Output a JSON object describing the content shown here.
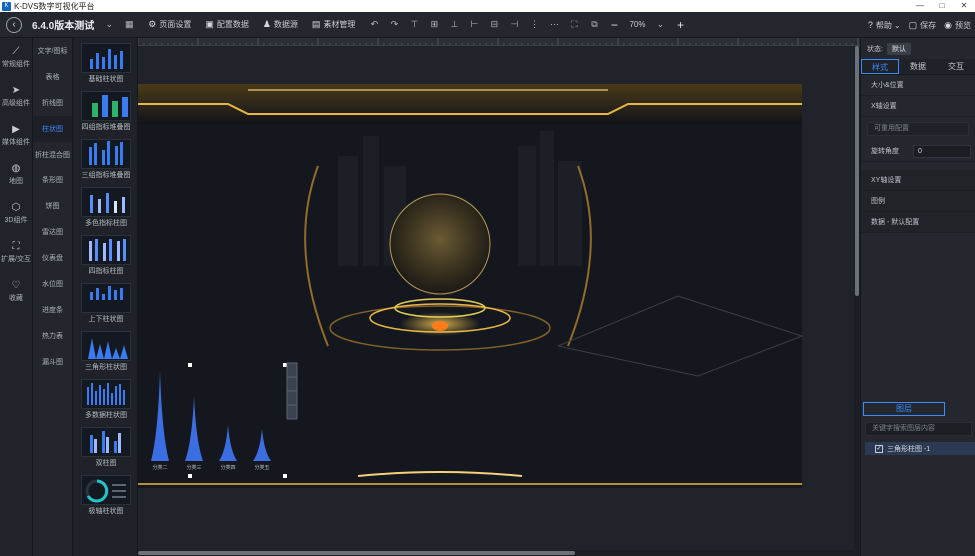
{
  "window": {
    "title": "K-DVS数字可视化平台",
    "controls": [
      "—",
      "□",
      "✕"
    ]
  },
  "toolbar": {
    "project_name": "6.4.0版本测试",
    "items": [
      {
        "name": "page-settings",
        "label": "页面设置",
        "icon": "gear-icon"
      },
      {
        "name": "config-data",
        "label": "配置数据",
        "icon": "screen-icon"
      },
      {
        "name": "data-source",
        "label": "数据源",
        "icon": "users-icon"
      },
      {
        "name": "material-mgmt",
        "label": "素材管理",
        "icon": "folder-icon"
      }
    ],
    "zoom": "70%",
    "help_label": "帮助",
    "save_label": "保存",
    "preview_label": "预览"
  },
  "iconbar": [
    {
      "label": "常规组件",
      "icon": "line-chart-icon"
    },
    {
      "label": "高级组件",
      "icon": "send-icon"
    },
    {
      "label": "媒体组件",
      "icon": "play-icon"
    },
    {
      "label": "地图",
      "icon": "globe-icon"
    },
    {
      "label": "3D组件",
      "icon": "cube-icon"
    },
    {
      "label": "扩展/交互",
      "icon": "expand-icon"
    },
    {
      "label": "收藏",
      "icon": "heart-icon"
    }
  ],
  "categories": [
    {
      "label": "文字/图标",
      "active": false
    },
    {
      "label": "表格",
      "active": false
    },
    {
      "label": "折线图",
      "active": false
    },
    {
      "label": "柱状图",
      "active": true
    },
    {
      "label": "折柱混合图",
      "active": false
    },
    {
      "label": "条形图",
      "active": false
    },
    {
      "label": "饼图",
      "active": false
    },
    {
      "label": "雷达图",
      "active": false
    },
    {
      "label": "仪表盘",
      "active": false
    },
    {
      "label": "水位图",
      "active": false
    },
    {
      "label": "进度条",
      "active": false
    },
    {
      "label": "热力表",
      "active": false
    },
    {
      "label": "漏斗图",
      "active": false
    }
  ],
  "thumbnails": [
    {
      "label": "基础柱状图"
    },
    {
      "label": "四组指标堆叠图"
    },
    {
      "label": "三组指标堆叠图"
    },
    {
      "label": "多色指标柱图"
    },
    {
      "label": "四指标柱图"
    },
    {
      "label": "上下柱状图"
    },
    {
      "label": "三角形柱状图"
    },
    {
      "label": "多数据柱状图"
    },
    {
      "label": "双柱图"
    },
    {
      "label": "极轴柱状图"
    }
  ],
  "canvas": {
    "chart_labels": [
      "分类二",
      "分类三",
      "分类四",
      "分类五"
    ]
  },
  "chart_data": {
    "type": "bar",
    "categories": [
      "分类二",
      "分类三",
      "分类四",
      "分类五"
    ],
    "values": [
      100,
      72,
      40,
      36
    ],
    "ylim": [
      0,
      100
    ]
  },
  "rightpanel": {
    "state_label": "状态:",
    "state_value": "默认",
    "tabs": [
      "样式",
      "数据",
      "交互"
    ],
    "rows": [
      {
        "label": "大小&位置"
      },
      {
        "label": "X轴设置"
      }
    ],
    "reuse_placeholder": "可重用配置",
    "rotation_label": "旋转角度",
    "rotation_value": "0",
    "rows2": [
      {
        "label": "XY轴设置"
      },
      {
        "label": "图例"
      },
      {
        "label": "数据 - 默认配置"
      }
    ],
    "layers_tab": "图层",
    "layer_search_placeholder": "关键字搜索图层内容",
    "layer_item": "三角形柱图 -1"
  },
  "colors": {
    "accent": "#3d8bff",
    "bar": "#3b6ee0",
    "gold": "#e8b547"
  }
}
